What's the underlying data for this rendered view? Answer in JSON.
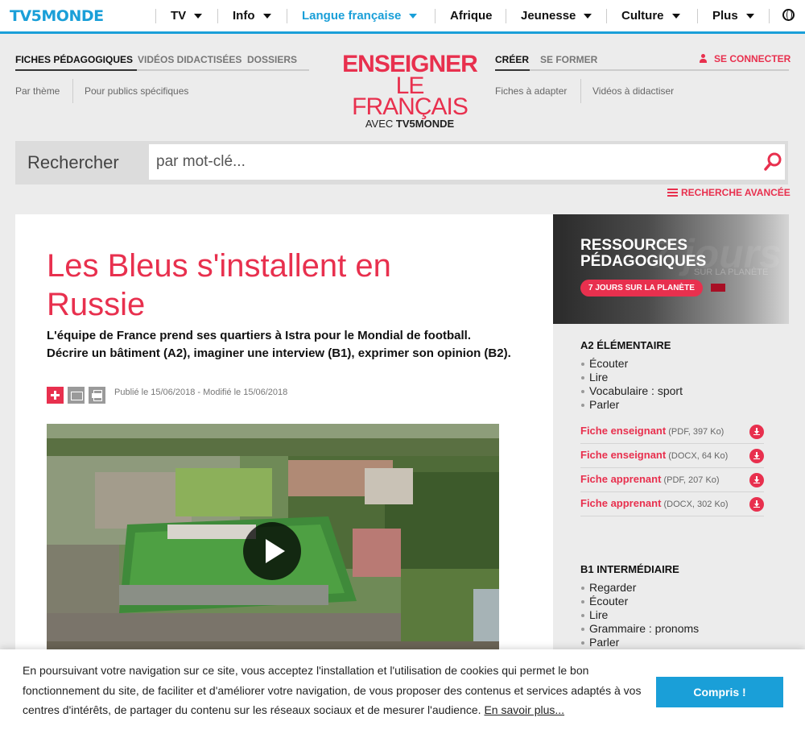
{
  "topnav": {
    "logo": "TV5MONDE",
    "items": [
      {
        "label": "TV"
      },
      {
        "label": "Info"
      },
      {
        "label": "Langue française"
      },
      {
        "label": "Afrique"
      },
      {
        "label": "Jeunesse"
      },
      {
        "label": "Culture"
      },
      {
        "label": "Plus"
      }
    ]
  },
  "subheader": {
    "left_tabs": [
      "FICHES PÉDAGOGIQUES",
      "VIDÉOS DIDACTISÉES",
      "DOSSIERS"
    ],
    "left_links": [
      "Par thème",
      "Pour publics spécifiques"
    ],
    "brand": {
      "line1": "ENSEIGNER",
      "line2": "LE FRANÇAIS",
      "line3_prefix": "AVEC",
      "line3_brand": "TV5MONDE"
    },
    "right_tabs": [
      "CRÉER",
      "SE FORMER"
    ],
    "right_links": [
      "Fiches à adapter",
      "Vidéos à didactiser"
    ],
    "login": "SE CONNECTER"
  },
  "search": {
    "label": "Rechercher",
    "placeholder": "par mot-clé...",
    "advanced": "RECHERCHE AVANCÉE"
  },
  "article": {
    "title": "Les Bleus s'installent en Russie",
    "lead": "L'équipe de France prend ses quartiers à Istra pour le Mondial de football. Décrire un bâtiment (A2), imaginer une interview (B1), exprimer son opinion (B2).",
    "published": "Publié le 15/06/2018 - Modifié le 15/06/2018"
  },
  "sidebar": {
    "banner_title": "RESSOURCES PÉDAGOGIQUES",
    "banner_pill": "7 JOURS SUR LA PLANÈTE",
    "banner_bg_text": "7 jours",
    "banner_bg_sub": "SUR LA PLANÈTE",
    "levels": [
      {
        "title": "A2 ÉLÉMENTAIRE",
        "skills": [
          "Écouter",
          "Lire",
          "Vocabulaire : sport",
          "Parler"
        ],
        "files": [
          {
            "name": "Fiche enseignant",
            "meta": "(PDF, 397 Ko)"
          },
          {
            "name": "Fiche enseignant",
            "meta": "(DOCX, 64 Ko)"
          },
          {
            "name": "Fiche apprenant",
            "meta": "(PDF, 207 Ko)"
          },
          {
            "name": "Fiche apprenant",
            "meta": "(DOCX, 302 Ko)"
          }
        ]
      },
      {
        "title": "B1 INTERMÉDIAIRE",
        "skills": [
          "Regarder",
          "Écouter",
          "Lire",
          "Grammaire : pronoms",
          "Parler"
        ]
      }
    ]
  },
  "cookie": {
    "text": "En poursuivant votre navigation sur ce site, vous acceptez l'installation et l'utilisation de cookies qui permet le bon fonctionnement du site, de faciliter et d'améliorer votre navigation, de vous proposer des contenus et services adaptés à vos centres d'intérêts, de partager du contenu sur les réseaux sociaux et de mesurer l'audience.",
    "link": "En savoir plus...",
    "button": "Compris !"
  },
  "colors": {
    "accent_blue": "#1a9fd8",
    "accent_red": "#e8304e"
  }
}
